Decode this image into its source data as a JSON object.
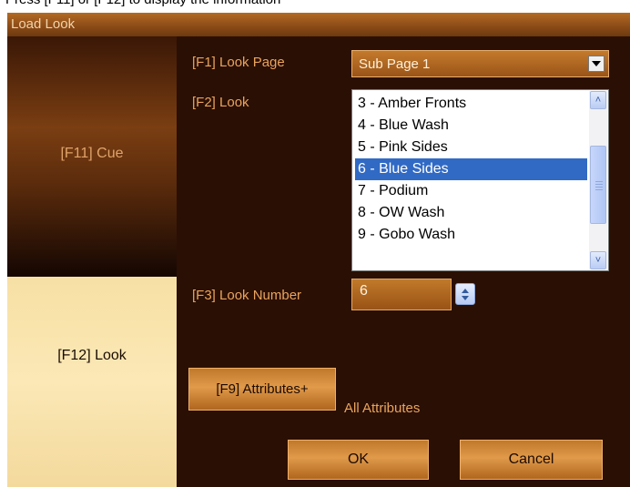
{
  "top_caption": "Press [F11] or [F12] to display the information",
  "title": "Load Look",
  "side": {
    "cue": "[F11] Cue",
    "look": "[F12] Look"
  },
  "look_page": {
    "label": "[F1] Look Page",
    "value": "Sub Page 1"
  },
  "look_list": {
    "label": "[F2] Look",
    "items": [
      "3 - Amber Fronts",
      "4 - Blue Wash",
      "5 - Pink Sides",
      "6 - Blue Sides",
      "7 - Podium",
      "8 - OW Wash",
      "9 - Gobo Wash"
    ],
    "selected": "6 - Blue Sides"
  },
  "look_number": {
    "label": "[F3] Look Number",
    "value": "6"
  },
  "attributes": {
    "button": "[F9] Attributes+",
    "text": "All Attributes"
  },
  "ok": "OK",
  "cancel": "Cancel",
  "colors": {
    "background": "#2a0f04",
    "label": "#eaa45e",
    "selection": "#316ac5"
  }
}
